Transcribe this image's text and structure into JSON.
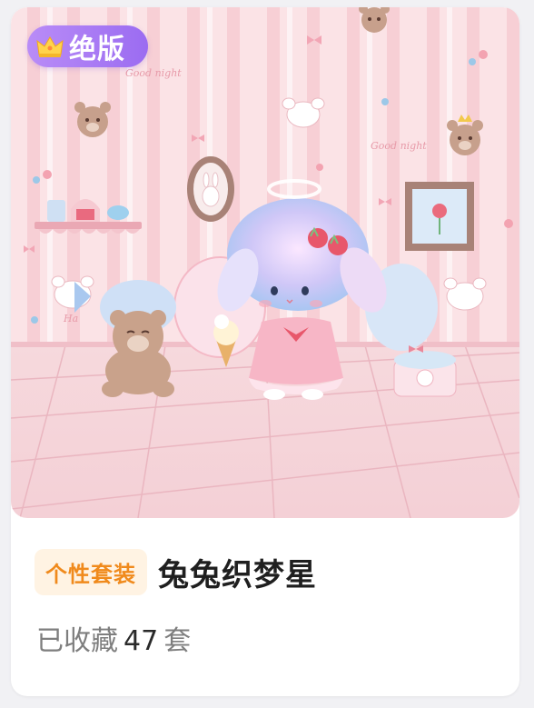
{
  "badge": {
    "label": "绝版",
    "icon": "crown-icon"
  },
  "artwork": {
    "wall_text_1": "Good night",
    "wall_text_2": "Good night",
    "wall_text_3": "Ha"
  },
  "item": {
    "tag": "个性套装",
    "title": "兔兔织梦星",
    "collected_prefix": "已收藏",
    "collected_count": "47",
    "collected_suffix": "套"
  },
  "colors": {
    "badge_gradient_start": "#b98cf7",
    "badge_gradient_end": "#9b6cf1",
    "tag_bg": "#fff3e3",
    "tag_text": "#f08a1c"
  }
}
